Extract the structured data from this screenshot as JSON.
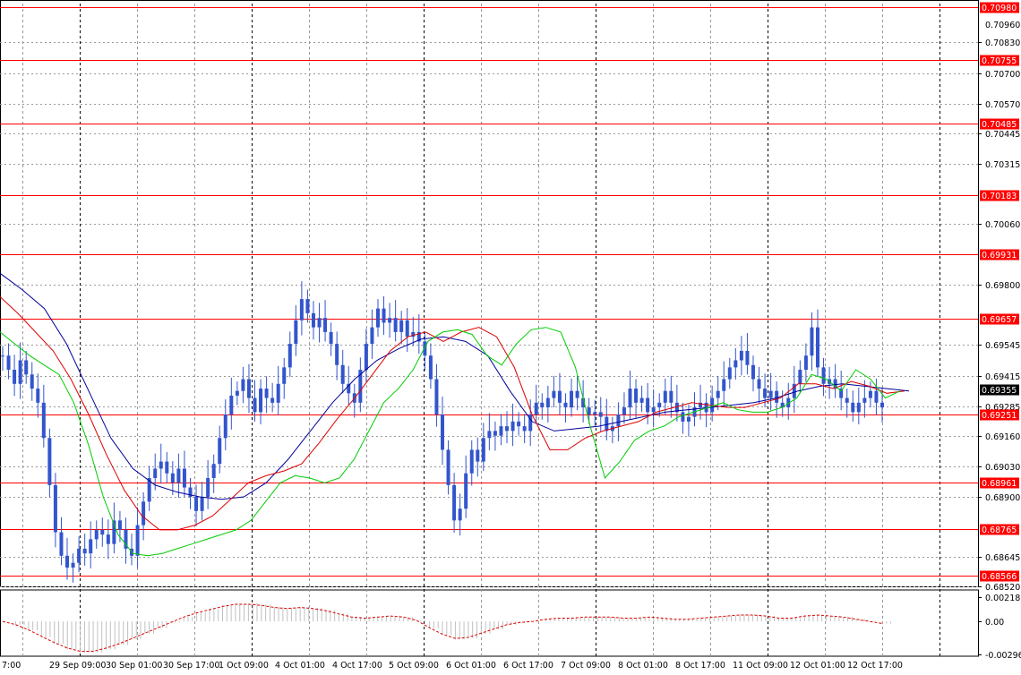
{
  "chart_data": {
    "type": "candlestick",
    "colors": {
      "candle": "#3355cc",
      "ma_fast": "#00cc00",
      "ma_mid": "#dd0000",
      "ma_slow": "#000099",
      "level_line": "#ff0000",
      "level_label_bg": "#ff0000",
      "current_label_bg": "#000000",
      "grid": "#999999",
      "vgrid_major": "#000000",
      "osc_hist": "#c0c0c0",
      "osc_signal": "#dd0000"
    },
    "y_axis": {
      "min": 0.6852,
      "max": 0.70995,
      "ticks": [
        "0.70830",
        "0.70700",
        "0.70570",
        "0.70445",
        "0.70315",
        "0.70060",
        "0.69800",
        "0.69545",
        "0.69415",
        "0.69285",
        "0.69160",
        "0.69030",
        "0.68900",
        "0.68645",
        "0.68520"
      ],
      "partial_top_label": "0.70960"
    },
    "levels": [
      "0.70980",
      "0.70755",
      "0.70485",
      "0.70183",
      "0.69931",
      "0.69657",
      "0.69251",
      "0.68961",
      "0.68765",
      "0.68566"
    ],
    "current_price": "0.69355",
    "x_labels": [
      "7:00",
      "29 Sep 09:00",
      "30 Sep 01:00",
      "30 Sep 17:00",
      "1 Oct 09:00",
      "4 Oct 01:00",
      "4 Oct 17:00",
      "5 Oct 09:00",
      "6 Oct 01:00",
      "6 Oct 17:00",
      "7 Oct 09:00",
      "8 Oct 01:00",
      "8 Oct 17:00",
      "11 Oct 09:00",
      "12 Oct 01:00",
      "12 Oct 17:00"
    ],
    "price_series_close": [
      0.695,
      0.6944,
      0.6938,
      0.6948,
      0.6942,
      0.6936,
      0.693,
      0.6915,
      0.6895,
      0.6875,
      0.6865,
      0.686,
      0.6862,
      0.6868,
      0.6866,
      0.6872,
      0.6876,
      0.6874,
      0.687,
      0.688,
      0.6876,
      0.6868,
      0.6865,
      0.6878,
      0.6888,
      0.6898,
      0.6902,
      0.6905,
      0.69,
      0.6896,
      0.6902,
      0.6894,
      0.689,
      0.6884,
      0.689,
      0.6898,
      0.6904,
      0.6915,
      0.6925,
      0.6933,
      0.6935,
      0.694,
      0.6932,
      0.6926,
      0.6936,
      0.6932,
      0.693,
      0.6938,
      0.6945,
      0.6955,
      0.6965,
      0.6974,
      0.6968,
      0.6962,
      0.6966,
      0.696,
      0.6955,
      0.6946,
      0.6938,
      0.6934,
      0.693,
      0.6944,
      0.6955,
      0.6962,
      0.697,
      0.6964,
      0.6966,
      0.696,
      0.6965,
      0.6958,
      0.696,
      0.6956,
      0.695,
      0.694,
      0.6925,
      0.691,
      0.6895,
      0.688,
      0.6885,
      0.69,
      0.691,
      0.6905,
      0.6915,
      0.6918,
      0.6916,
      0.692,
      0.6918,
      0.6922,
      0.692,
      0.6918,
      0.6925,
      0.693,
      0.6928,
      0.6932,
      0.6935,
      0.693,
      0.6928,
      0.6935,
      0.6932,
      0.6928,
      0.6925,
      0.6926,
      0.6924,
      0.6918,
      0.692,
      0.6925,
      0.6928,
      0.6936,
      0.693,
      0.6932,
      0.6926,
      0.6928,
      0.693,
      0.6935,
      0.693,
      0.6926,
      0.6922,
      0.6924,
      0.6928,
      0.693,
      0.6926,
      0.6932,
      0.6935,
      0.694,
      0.6945,
      0.6948,
      0.6952,
      0.6946,
      0.694,
      0.6936,
      0.6932,
      0.6935,
      0.693,
      0.6928,
      0.6932,
      0.6938,
      0.6944,
      0.695,
      0.6962,
      0.6945,
      0.6938,
      0.694,
      0.6936,
      0.6932,
      0.693,
      0.6926,
      0.693,
      0.6932,
      0.6935,
      0.693,
      0.6928
    ],
    "ma_fast": [
      0.696,
      0.6955,
      0.695,
      0.6946,
      0.6942,
      0.693,
      0.6912,
      0.689,
      0.6874,
      0.6866,
      0.6865,
      0.6866,
      0.6868,
      0.687,
      0.6872,
      0.6874,
      0.6876,
      0.688,
      0.6888,
      0.6896,
      0.6899,
      0.6898,
      0.6896,
      0.6898,
      0.6906,
      0.6918,
      0.693,
      0.6936,
      0.6944,
      0.6956,
      0.696,
      0.6961,
      0.6959,
      0.695,
      0.6946,
      0.6955,
      0.6961,
      0.6962,
      0.696,
      0.6945,
      0.692,
      0.6898,
      0.6905,
      0.6914,
      0.6918,
      0.692,
      0.6924,
      0.6926,
      0.6928,
      0.693,
      0.6927,
      0.6926,
      0.6926,
      0.6928,
      0.6932,
      0.6942,
      0.694,
      0.6935,
      0.6944,
      0.694,
      0.6932,
      0.6935
    ],
    "ma_mid": [
      0.6975,
      0.6968,
      0.696,
      0.6952,
      0.694,
      0.6925,
      0.6908,
      0.6893,
      0.6882,
      0.6876,
      0.6876,
      0.6878,
      0.6882,
      0.6889,
      0.6896,
      0.6899,
      0.6901,
      0.6904,
      0.6913,
      0.6923,
      0.6932,
      0.6942,
      0.6952,
      0.6958,
      0.696,
      0.6956,
      0.696,
      0.6962,
      0.6958,
      0.6945,
      0.6925,
      0.691,
      0.691,
      0.6915,
      0.6918,
      0.692,
      0.6922,
      0.6926,
      0.6928,
      0.693,
      0.6929,
      0.6928,
      0.6928,
      0.693,
      0.6932,
      0.6938,
      0.6938,
      0.6936,
      0.6939,
      0.6937,
      0.6934,
      0.6935
    ],
    "ma_slow": [
      0.6985,
      0.6978,
      0.697,
      0.6955,
      0.6935,
      0.6915,
      0.6902,
      0.6895,
      0.6892,
      0.689,
      0.6889,
      0.689,
      0.6896,
      0.6906,
      0.6918,
      0.693,
      0.694,
      0.6948,
      0.6953,
      0.6957,
      0.6958,
      0.6956,
      0.695,
      0.6935,
      0.6922,
      0.6918,
      0.6919,
      0.692,
      0.6922,
      0.6924,
      0.6926,
      0.6927,
      0.6928,
      0.6929,
      0.693,
      0.6932,
      0.6935,
      0.6937,
      0.6938,
      0.6937,
      0.6936,
      0.6935
    ],
    "oscillator": {
      "ticks": [
        "0.002185",
        "0.00",
        "-0.002966"
      ],
      "min": -0.0031,
      "max": 0.0024,
      "values": [
        0.0,
        -0.0003,
        -0.0008,
        -0.0014,
        -0.002,
        -0.0025,
        -0.0028,
        -0.0028,
        -0.0025,
        -0.0021,
        -0.0016,
        -0.0011,
        -0.0006,
        -0.0001,
        0.0004,
        0.0008,
        0.0011,
        0.0014,
        0.0016,
        0.0016,
        0.0015,
        0.0013,
        0.0012,
        0.0013,
        0.0012,
        0.001,
        0.0007,
        0.0004,
        0.0003,
        0.0004,
        0.0005,
        0.0004,
        0.0001,
        -0.0006,
        -0.0012,
        -0.0016,
        -0.0015,
        -0.0011,
        -0.0007,
        -0.0003,
        -0.0001,
        0.0,
        0.0002,
        0.0003,
        0.0003,
        0.0004,
        0.0004,
        0.0004,
        0.0003,
        0.0003,
        0.0004,
        0.0003,
        0.0002,
        0.0002,
        0.0003,
        0.0004,
        0.0005,
        0.0006,
        0.0006,
        0.0005,
        0.0003,
        0.0003,
        0.0005,
        0.0006,
        0.0005,
        0.0004,
        0.0002,
        0.0,
        -0.0002
      ]
    }
  }
}
